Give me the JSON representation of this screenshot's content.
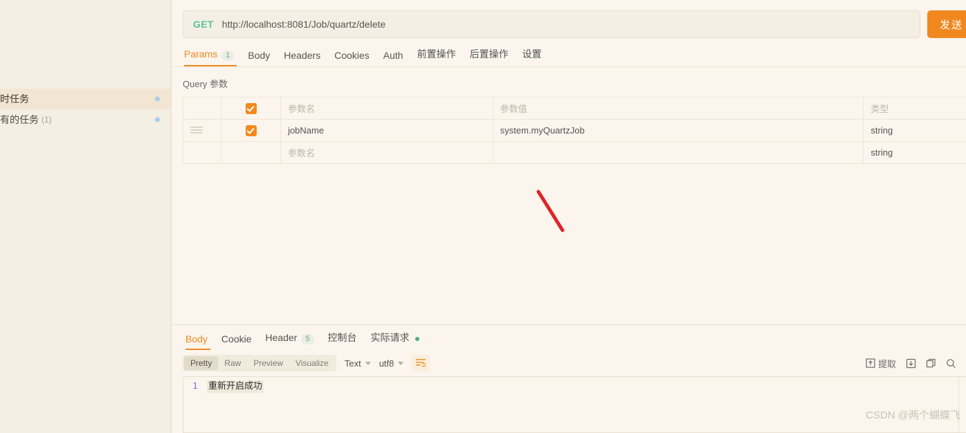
{
  "sidebar": {
    "partial_text": ")",
    "items": [
      {
        "label": "定时任务",
        "count": "",
        "active": true
      },
      {
        "label": "所有的任务",
        "count": "(1)",
        "active": false
      }
    ]
  },
  "request": {
    "method": "GET",
    "url": "http://localhost:8081/Job/quartz/delete",
    "send_label": "发送",
    "tabs": [
      {
        "label": "Params",
        "badge": "1",
        "active": true
      },
      {
        "label": "Body",
        "badge": "",
        "active": false
      },
      {
        "label": "Headers",
        "badge": "",
        "active": false
      },
      {
        "label": "Cookies",
        "badge": "",
        "active": false
      },
      {
        "label": "Auth",
        "badge": "",
        "active": false
      },
      {
        "label": "前置操作",
        "badge": "",
        "active": false
      },
      {
        "label": "后置操作",
        "badge": "",
        "active": false
      },
      {
        "label": "设置",
        "badge": "",
        "active": false
      }
    ]
  },
  "params": {
    "section_title": "Query 参数",
    "headers": {
      "name": "参数名",
      "value": "参数值",
      "type": "类型"
    },
    "rows": [
      {
        "handle": false,
        "checked": true,
        "name": "",
        "name_placeholder": "参数名",
        "value": "",
        "value_placeholder": "参数值",
        "type": "类型",
        "is_header": true
      },
      {
        "handle": true,
        "checked": true,
        "name": "jobName",
        "name_placeholder": "",
        "value": "system.myQuartzJob",
        "value_placeholder": "",
        "type": "string",
        "is_header": false
      },
      {
        "handle": false,
        "checked": false,
        "name": "",
        "name_placeholder": "参数名",
        "value": "",
        "value_placeholder": "",
        "type": "string",
        "is_header": false
      }
    ]
  },
  "response": {
    "tabs": [
      {
        "label": "Body",
        "badge": "",
        "dot": false,
        "active": true
      },
      {
        "label": "Cookie",
        "badge": "",
        "dot": false,
        "active": false
      },
      {
        "label": "Header",
        "badge": "5",
        "dot": false,
        "active": false
      },
      {
        "label": "控制台",
        "badge": "",
        "dot": false,
        "active": false
      },
      {
        "label": "实际请求",
        "badge": "",
        "dot": true,
        "active": false
      }
    ],
    "view_modes": [
      {
        "label": "Pretty",
        "active": true
      },
      {
        "label": "Raw",
        "active": false
      },
      {
        "label": "Preview",
        "active": false
      },
      {
        "label": "Visualize",
        "active": false
      }
    ],
    "format_select": "Text",
    "encoding_select": "utf8",
    "extract_label": "提取",
    "icons": {
      "wrap": "wrap-text-icon",
      "extract": "extract-icon",
      "download": "download-icon",
      "copy": "copy-icon",
      "search": "search-icon"
    },
    "body_lines": [
      {
        "num": "1",
        "text": "重新开启成功"
      }
    ]
  },
  "watermark": "CSDN @两个蝴蝶飞",
  "colors": {
    "accent_orange": "#ef8a21",
    "method_green": "#5cc29a",
    "annotation_red": "#e0242a",
    "sidebar_active_bg": "#f2e6d2",
    "page_bg": "#fbf5ee"
  }
}
